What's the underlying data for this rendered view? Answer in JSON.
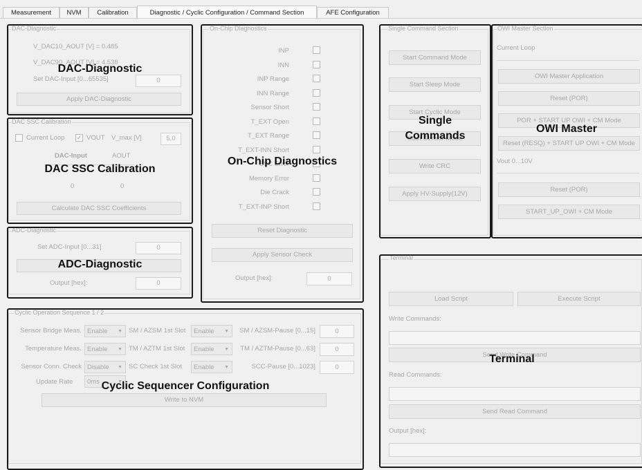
{
  "tabs": [
    "Measurement",
    "NVM",
    "Calibration",
    "Diagnostic / Cyclic Configuration / Command Section",
    "AFE Configuration"
  ],
  "dac_diag": {
    "group_title": "DAC-Diagnostic",
    "vdac10": "V_DAC10_AOUT [V] = 0.485",
    "vdac90": "V_DAC90_AOUT [V] = 4.538",
    "set_input_label": "Set DAC-Input [0...65535]",
    "set_input_value": "0",
    "apply_button": "Apply DAC-Diagnostic",
    "overlay": "DAC-Diagnostic"
  },
  "dac_ssc": {
    "group_title": "DAC SSC Calibration",
    "current_loop": "Current Loop",
    "vout": "VOUT",
    "vmax_label": "V_max [V]",
    "vmax_value": "5.0",
    "col_dac_input": "DAC-Input",
    "col_aout": "AOUT",
    "val_dac": "0",
    "val_aout": "0",
    "calc_button": "Calculate DAC SSC Coefficients",
    "overlay": "DAC SSC Calibration"
  },
  "adc_diag": {
    "group_title": "ADC-Diagnostic",
    "set_input_label": "Set ADC-Input [0...31]",
    "set_input_value": "0",
    "output_label": "Output [hex]:",
    "output_value": "0",
    "overlay": "ADC-Diagnostic"
  },
  "onchip": {
    "group_title": "On-Chip Diagnostics",
    "items": [
      "INP",
      "INN",
      "INP Range",
      "INN Range",
      "Sensor Short",
      "T_EXT Open",
      "T_EXT Range",
      "T_EXT-INN Short",
      "SSC Error",
      "Memory Error",
      "Die Crack",
      "T_EXT-INP Short"
    ],
    "reset_button": "Reset Diagnostic",
    "apply_button": "Apply Sensor Check",
    "output_label": "Output [hex]:",
    "output_value": "0",
    "overlay": "On-Chip Diagnostics"
  },
  "single": {
    "group_title": "Single Command Section",
    "buttons": [
      "Start Command Mode",
      "Start Sleep Mode",
      "Start Cyclic Mode",
      "Start Sensor Mode",
      "Write CRC",
      "Apply HV-Supply(12V)"
    ],
    "overlay_line1": "Single",
    "overlay_line2": "Commands"
  },
  "owi": {
    "group_title": "OWI Master Section",
    "current_loop": "Current Loop",
    "buttons_top": [
      "OWI Master Application",
      "Reset (POR)",
      "POR + START UP OWI + CM Mode",
      "Reset (RESQ) + START UP OWI + CM Mode"
    ],
    "vout_label": "Vout 0...10V",
    "buttons_bottom": [
      "Reset (POR)",
      "START_UP_OWI + CM Mode"
    ],
    "overlay": "OWI Master"
  },
  "cyclic": {
    "group_title": "Cyclic Operation Sequence 1 / 2",
    "rows": [
      {
        "label": "Sensor Bridge Meas.",
        "sel1": "Enable",
        "slot_label": "SM / AZSM 1st Slot",
        "sel2": "Enable",
        "pause_label": "SM / AZSM-Pause [0...15]",
        "value": "0"
      },
      {
        "label": "Temperature Meas.",
        "sel1": "Enable",
        "slot_label": "TM / AZTM 1st Slot",
        "sel2": "Enable",
        "pause_label": "TM / AZTM-Pause [0...63]",
        "value": "0"
      },
      {
        "label": "Sensor Conn. Check",
        "sel1": "Disable",
        "slot_label": "SC Check 1st Slot",
        "sel2": "Enable",
        "pause_label": "SCC-Pause [0...1023]",
        "value": "0"
      }
    ],
    "update_label": "Update Rate",
    "update_value": "0ms",
    "write_button": "Write to NVM",
    "overlay": "Cyclic Sequencer Configuration"
  },
  "terminal": {
    "group_title": "Terminal",
    "load_button": "Load Script",
    "execute_button": "Execute Script",
    "write_label": "Write Commands:",
    "send_write_button": "Send Write Command",
    "read_label": "Read Commands:",
    "send_read_button": "Send Read Command",
    "output_label": "Output [hex]:",
    "overlay": "Terminal"
  }
}
